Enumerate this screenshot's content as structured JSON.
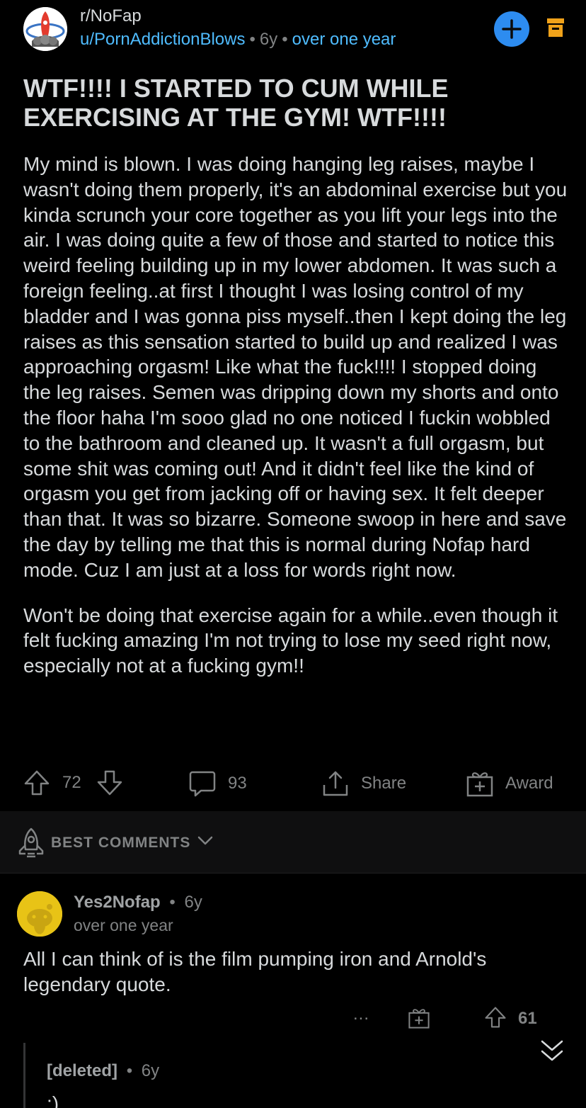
{
  "header": {
    "subreddit": "r/NoFap",
    "author": "u/PornAddictionBlows",
    "age": "6y",
    "since": "over one year",
    "join_icon": "plus-icon",
    "archive_icon": "archive-icon",
    "accent": "#2d8cf0"
  },
  "post": {
    "title": "WTF!!!! I STARTED TO CUM WHILE EXERCISING AT THE GYM! WTF!!!!",
    "paragraphs": [
      "My mind is blown.  I was doing hanging leg raises, maybe I wasn't doing them properly, it's an abdominal exercise but you kinda scrunch your core together as you lift your legs into the air.  I was doing quite a few of those and started to notice this weird feeling building up in my lower abdomen.  It was such a foreign feeling..at first I thought I was losing control of my bladder and I was gonna piss myself..then I kept doing the leg raises as this sensation started to build up and realized I was approaching orgasm! Like what the fuck!!!! I stopped doing the leg raises.  Semen was dripping down my shorts and onto the floor haha I'm sooo glad no one noticed I fuckin wobbled to the bathroom and cleaned up.  It wasn't a full orgasm, but some shit was coming out! And it didn't feel like the kind of orgasm you get from jacking off or having sex.  It felt deeper than that.  It was so bizarre.  Someone swoop in here and save the day by telling me that this is normal during Nofap hard mode.  Cuz I am just at a loss for words right now.",
      "Won't be doing that exercise again for a while..even though it felt fucking amazing I'm not trying to lose my seed right now, especially not at a fucking gym!!"
    ],
    "score": "72",
    "comments": "93",
    "share_label": "Share",
    "award_label": "Award"
  },
  "sort": {
    "label": "BEST COMMENTS"
  },
  "comments": [
    {
      "author": "Yes2Nofap",
      "age": "6y",
      "since": "over one year",
      "text": "All I can think of is the film pumping iron and Arnold's legendary quote.",
      "more": "...",
      "score": "61"
    }
  ],
  "reply": {
    "author": "[deleted]",
    "age": "6y",
    "text": ":)"
  }
}
